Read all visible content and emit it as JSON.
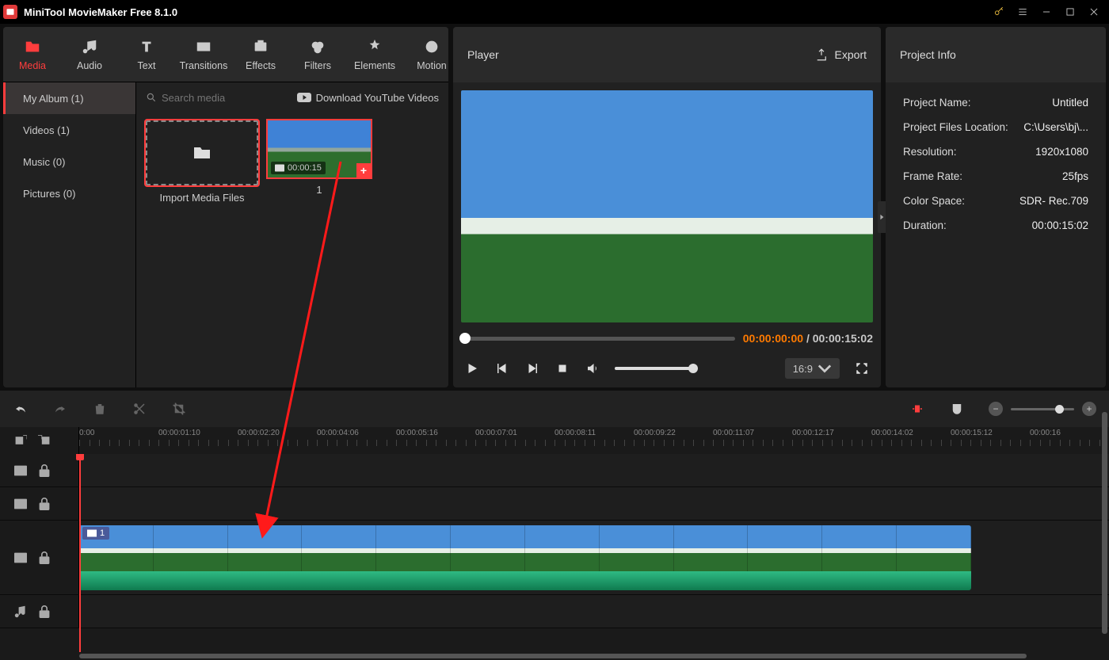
{
  "app_title": "MiniTool MovieMaker Free 8.1.0",
  "tabs": {
    "media": "Media",
    "audio": "Audio",
    "text": "Text",
    "transition": "Transitions",
    "effects": "Effects",
    "filters": "Filters",
    "elements": "Elements",
    "motion": "Motion"
  },
  "sidebar": {
    "album": "My Album (1)",
    "videos": "Videos (1)",
    "music": "Music (0)",
    "pictures": "Pictures (0)"
  },
  "media_toolbar": {
    "search_placeholder": "Search media",
    "download_youtube": "Download YouTube Videos"
  },
  "media_items": {
    "import_label": "Import Media Files",
    "clip1_duration": "00:00:15",
    "clip1_label": "1"
  },
  "player": {
    "title": "Player",
    "export": "Export",
    "cur_time": "00:00:00:00",
    "divider": "/",
    "total_time": "00:00:15:02",
    "aspect": "16:9"
  },
  "project_info": {
    "title": "Project Info",
    "rows": {
      "name_k": "Project Name:",
      "name_v": "Untitled",
      "loc_k": "Project Files Location:",
      "loc_v": "C:\\Users\\bj\\...",
      "res_k": "Resolution:",
      "res_v": "1920x1080",
      "fps_k": "Frame Rate:",
      "fps_v": "25fps",
      "cs_k": "Color Space:",
      "cs_v": "SDR- Rec.709",
      "dur_k": "Duration:",
      "dur_v": "00:00:15:02"
    }
  },
  "ruler": [
    "0:00",
    "00:00:01:10",
    "00:00:02:20",
    "00:00:04:06",
    "00:00:05:16",
    "00:00:07:01",
    "00:00:08:11",
    "00:00:09:22",
    "00:00:11:07",
    "00:00:12:17",
    "00:00:14:02",
    "00:00:15:12",
    "00:00:16"
  ],
  "timeline_clip_label": "1"
}
